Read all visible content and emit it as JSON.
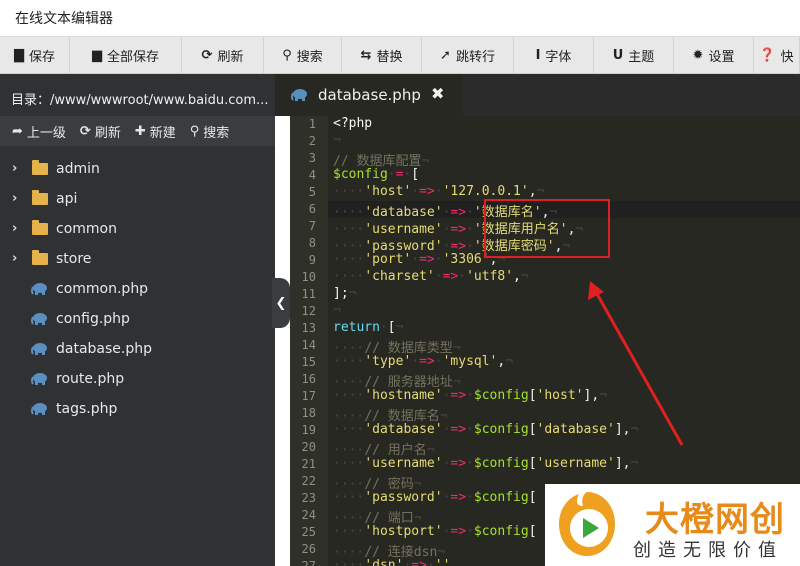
{
  "window": {
    "title": "在线文本编辑器"
  },
  "toolbar": [
    {
      "icon": "save-icon",
      "glyph": "▇",
      "label": "保存",
      "width": 70
    },
    {
      "icon": "save-all-icon",
      "glyph": "▆",
      "label": "全部保存",
      "width": 112
    },
    {
      "icon": "refresh-icon",
      "glyph": "⟳",
      "label": "刷新",
      "width": 82
    },
    {
      "icon": "search-icon",
      "glyph": "⚲",
      "label": "搜索",
      "width": 78
    },
    {
      "icon": "replace-icon",
      "glyph": "⇆",
      "label": "替换",
      "width": 80
    },
    {
      "icon": "goto-line-icon",
      "glyph": "➚",
      "label": "跳转行",
      "width": 92
    },
    {
      "icon": "font-icon",
      "glyph": "Ⅰ",
      "label": "字体",
      "width": 80
    },
    {
      "icon": "theme-icon",
      "glyph": "U",
      "label": "主题",
      "width": 80
    },
    {
      "icon": "settings-icon",
      "glyph": "✹",
      "label": "设置",
      "width": 80
    },
    {
      "icon": "shortcut-icon",
      "glyph": "❓",
      "label": "快",
      "width": 46
    }
  ],
  "sidebar": {
    "path_label": "目录：/www/wwwroot/www.baidu.com...",
    "actions": [
      {
        "icon": "up-level-icon",
        "glyph": "➦",
        "label": "上一级"
      },
      {
        "icon": "refresh-icon",
        "glyph": "⟳",
        "label": "刷新"
      },
      {
        "icon": "plus-icon",
        "glyph": "✚",
        "label": "新建"
      },
      {
        "icon": "search-icon",
        "glyph": "⚲",
        "label": "搜索"
      }
    ],
    "folders": [
      "admin",
      "api",
      "common",
      "store"
    ],
    "files": [
      "common.php",
      "config.php",
      "database.php",
      "route.php",
      "tags.php"
    ],
    "collapse_glyph": "❮"
  },
  "editor": {
    "tab_label": "database.php",
    "close_glyph": "✖",
    "lines": [
      [
        [
          "c-plain",
          "<?php"
        ]
      ],
      [
        [
          "c-ws",
          "¬"
        ]
      ],
      [
        [
          "c-com",
          "// 数据库配置"
        ],
        [
          "c-ws",
          "¬"
        ]
      ],
      [
        [
          "c-var",
          "$config"
        ],
        [
          "c-ws",
          "·"
        ],
        [
          "c-op",
          "="
        ],
        [
          "c-ws",
          "·"
        ],
        [
          "c-plain",
          "["
        ]
      ],
      [
        [
          "c-ws",
          "····"
        ],
        [
          "c-str",
          "'host'"
        ],
        [
          "c-ws",
          "·"
        ],
        [
          "c-op",
          "=>"
        ],
        [
          "c-ws",
          "·"
        ],
        [
          "c-str",
          "'127.0.0.1'"
        ],
        [
          "c-plain",
          ","
        ],
        [
          "c-ws",
          "¬"
        ]
      ],
      [
        [
          "c-ws",
          "····"
        ],
        [
          "c-str",
          "'database'"
        ],
        [
          "c-ws",
          "·"
        ],
        [
          "c-op",
          "=>"
        ],
        [
          "c-ws",
          "·"
        ],
        [
          "c-str",
          "'数据库名'"
        ],
        [
          "c-plain",
          ","
        ],
        [
          "c-ws",
          "¬"
        ]
      ],
      [
        [
          "c-ws",
          "····"
        ],
        [
          "c-str",
          "'username'"
        ],
        [
          "c-ws",
          "·"
        ],
        [
          "c-op",
          "=>"
        ],
        [
          "c-ws",
          "·"
        ],
        [
          "c-str",
          "'数据库用户名'"
        ],
        [
          "c-plain",
          ","
        ],
        [
          "c-ws",
          "¬"
        ]
      ],
      [
        [
          "c-ws",
          "····"
        ],
        [
          "c-str",
          "'password'"
        ],
        [
          "c-ws",
          "·"
        ],
        [
          "c-op",
          "=>"
        ],
        [
          "c-ws",
          "·"
        ],
        [
          "c-str",
          "'数据库密码'"
        ],
        [
          "c-plain",
          ","
        ],
        [
          "c-ws",
          "¬"
        ]
      ],
      [
        [
          "c-ws",
          "····"
        ],
        [
          "c-str",
          "'port'"
        ],
        [
          "c-ws",
          "·"
        ],
        [
          "c-op",
          "=>"
        ],
        [
          "c-ws",
          "·"
        ],
        [
          "c-str",
          "'3306'"
        ],
        [
          "c-plain",
          ","
        ],
        [
          "c-ws",
          "¬"
        ]
      ],
      [
        [
          "c-ws",
          "····"
        ],
        [
          "c-str",
          "'charset'"
        ],
        [
          "c-ws",
          "·"
        ],
        [
          "c-op",
          "=>"
        ],
        [
          "c-ws",
          "·"
        ],
        [
          "c-str",
          "'utf8'"
        ],
        [
          "c-plain",
          ","
        ],
        [
          "c-ws",
          "¬"
        ]
      ],
      [
        [
          "c-plain",
          "];"
        ],
        [
          "c-ws",
          "¬"
        ]
      ],
      [
        [
          "c-ws",
          "¬"
        ]
      ],
      [
        [
          "c-kw",
          "return"
        ],
        [
          "c-ws",
          "·"
        ],
        [
          "c-plain",
          "["
        ],
        [
          "c-ws",
          "¬"
        ]
      ],
      [
        [
          "c-ws",
          "····"
        ],
        [
          "c-com",
          "// 数据库类型"
        ],
        [
          "c-ws",
          "¬"
        ]
      ],
      [
        [
          "c-ws",
          "····"
        ],
        [
          "c-str",
          "'type'"
        ],
        [
          "c-ws",
          "·"
        ],
        [
          "c-op",
          "=>"
        ],
        [
          "c-ws",
          "·"
        ],
        [
          "c-str",
          "'mysql'"
        ],
        [
          "c-plain",
          ","
        ],
        [
          "c-ws",
          "¬"
        ]
      ],
      [
        [
          "c-ws",
          "····"
        ],
        [
          "c-com",
          "// 服务器地址"
        ],
        [
          "c-ws",
          "¬"
        ]
      ],
      [
        [
          "c-ws",
          "····"
        ],
        [
          "c-str",
          "'hostname'"
        ],
        [
          "c-ws",
          "·"
        ],
        [
          "c-op",
          "=>"
        ],
        [
          "c-ws",
          "·"
        ],
        [
          "c-var",
          "$config"
        ],
        [
          "c-plain",
          "["
        ],
        [
          "c-str",
          "'host'"
        ],
        [
          "c-plain",
          "],"
        ],
        [
          "c-ws",
          "¬"
        ]
      ],
      [
        [
          "c-ws",
          "····"
        ],
        [
          "c-com",
          "// 数据库名"
        ],
        [
          "c-ws",
          "¬"
        ]
      ],
      [
        [
          "c-ws",
          "····"
        ],
        [
          "c-str",
          "'database'"
        ],
        [
          "c-ws",
          "·"
        ],
        [
          "c-op",
          "=>"
        ],
        [
          "c-ws",
          "·"
        ],
        [
          "c-var",
          "$config"
        ],
        [
          "c-plain",
          "["
        ],
        [
          "c-str",
          "'database'"
        ],
        [
          "c-plain",
          "],"
        ],
        [
          "c-ws",
          "¬"
        ]
      ],
      [
        [
          "c-ws",
          "····"
        ],
        [
          "c-com",
          "// 用户名"
        ],
        [
          "c-ws",
          "¬"
        ]
      ],
      [
        [
          "c-ws",
          "····"
        ],
        [
          "c-str",
          "'username'"
        ],
        [
          "c-ws",
          "·"
        ],
        [
          "c-op",
          "=>"
        ],
        [
          "c-ws",
          "·"
        ],
        [
          "c-var",
          "$config"
        ],
        [
          "c-plain",
          "["
        ],
        [
          "c-str",
          "'username'"
        ],
        [
          "c-plain",
          "],"
        ],
        [
          "c-ws",
          "¬"
        ]
      ],
      [
        [
          "c-ws",
          "····"
        ],
        [
          "c-com",
          "// 密码"
        ],
        [
          "c-ws",
          "¬"
        ]
      ],
      [
        [
          "c-ws",
          "····"
        ],
        [
          "c-str",
          "'password'"
        ],
        [
          "c-ws",
          "·"
        ],
        [
          "c-op",
          "=>"
        ],
        [
          "c-ws",
          "·"
        ],
        [
          "c-var",
          "$config"
        ],
        [
          "c-plain",
          "["
        ]
      ],
      [
        [
          "c-ws",
          "····"
        ],
        [
          "c-com",
          "// 端口"
        ],
        [
          "c-ws",
          "¬"
        ]
      ],
      [
        [
          "c-ws",
          "····"
        ],
        [
          "c-str",
          "'hostport'"
        ],
        [
          "c-ws",
          "·"
        ],
        [
          "c-op",
          "=>"
        ],
        [
          "c-ws",
          "·"
        ],
        [
          "c-var",
          "$config"
        ],
        [
          "c-plain",
          "["
        ]
      ],
      [
        [
          "c-ws",
          "····"
        ],
        [
          "c-com",
          "// 连接dsn"
        ],
        [
          "c-ws",
          "¬"
        ]
      ],
      [
        [
          "c-ws",
          "····"
        ],
        [
          "c-str",
          "'dsn'"
        ],
        [
          "c-ws",
          "·"
        ],
        [
          "c-op",
          "=>"
        ],
        [
          "c-ws",
          "·"
        ],
        [
          "c-str",
          "''"
        ]
      ]
    ]
  },
  "logo": {
    "main_text": "大橙网创",
    "sub_text": "创造无限价值"
  },
  "colors": {
    "accent_red": "#e02020",
    "logo_orange": "#e88a1a",
    "editor_bg": "#272822",
    "sidebar_bg": "#2f3133"
  }
}
